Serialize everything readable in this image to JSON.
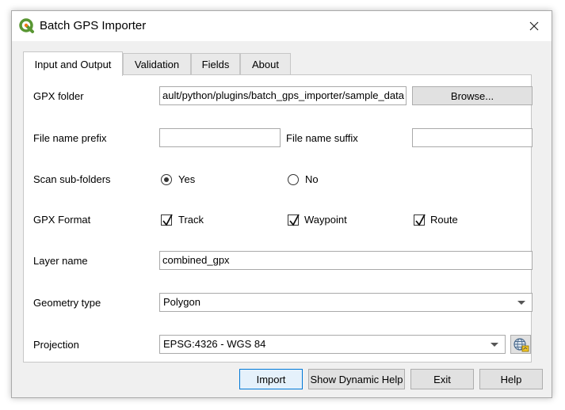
{
  "window": {
    "title": "Batch GPS Importer"
  },
  "tabs": [
    {
      "label": "Input and Output",
      "active": true
    },
    {
      "label": "Validation",
      "active": false
    },
    {
      "label": "Fields",
      "active": false
    },
    {
      "label": "About",
      "active": false
    }
  ],
  "form": {
    "gpx_folder": {
      "label": "GPX folder",
      "value": "ault/python/plugins/batch_gps_importer/sample_data",
      "browse_label": "Browse..."
    },
    "file_name_prefix": {
      "label": "File name prefix",
      "value": ""
    },
    "file_name_suffix": {
      "label": "File name suffix",
      "value": ""
    },
    "scan_sub_folders": {
      "label": "Scan sub-folders",
      "yes_label": "Yes",
      "no_label": "No",
      "selected": "Yes"
    },
    "gpx_format": {
      "label": "GPX Format",
      "track_label": "Track",
      "track_checked": true,
      "waypoint_label": "Waypoint",
      "waypoint_checked": true,
      "route_label": "Route",
      "route_checked": true
    },
    "layer_name": {
      "label": "Layer name",
      "value": "combined_gpx"
    },
    "geometry_type": {
      "label": "Geometry type",
      "value": "Polygon"
    },
    "projection": {
      "label": "Projection",
      "value": "EPSG:4326 - WGS 84"
    }
  },
  "buttons": {
    "import": "Import",
    "dynamic_help": "Show Dynamic Help",
    "exit": "Exit",
    "help": "Help"
  },
  "colors": {
    "accent": "#0078d7",
    "qgis_green": "#589632",
    "qgis_yellow": "#ee7913"
  },
  "icons": {
    "app": "qgis-logo-icon",
    "close": "close-icon",
    "projection_selector": "globe-projection-icon"
  }
}
